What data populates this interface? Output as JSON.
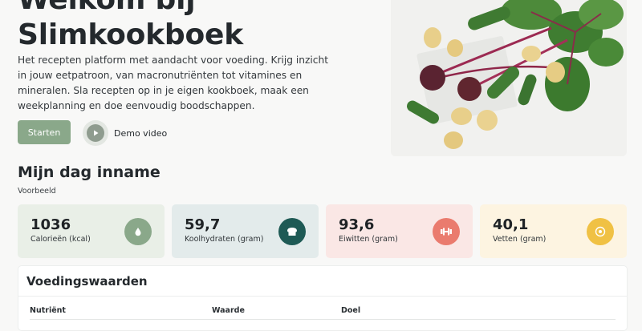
{
  "hero": {
    "title_line1": "Welkom bij",
    "title_line2": "Slimkookboek",
    "description": "Het recepten platform met aandacht voor voeding. Krijg inzicht in jouw eetpatroon, van macronutriënten tot vitamines en mineralen. Sla recepten op in je eigen kookboek, maak een weekplanning en doe eenvoudig boodschappen.",
    "start_button": "Starten",
    "demo_label": "Demo video"
  },
  "intake": {
    "title": "Mijn dag inname",
    "subtitle": "Voorbeeld",
    "cards": [
      {
        "value": "1036",
        "label": "Calorieën (kcal)",
        "bg": "#e9efe7",
        "icon_bg": "#8aa88a",
        "icon": "drop-icon"
      },
      {
        "value": "59,7",
        "label": "Koolhydraten (gram)",
        "bg": "#e3ebeb",
        "icon_bg": "#1e5a55",
        "icon": "bread-icon"
      },
      {
        "value": "93,6",
        "label": "Eiwitten (gram)",
        "bg": "#fae7e5",
        "icon_bg": "#ea7b6e",
        "icon": "dumbbell-icon"
      },
      {
        "value": "40,1",
        "label": "Vetten (gram)",
        "bg": "#fdf4e1",
        "icon_bg": "#f0c144",
        "icon": "oil-icon"
      }
    ]
  },
  "nutrition": {
    "title": "Voedingswaarden",
    "headers": [
      "Nutriënt",
      "Waarde",
      "Doel"
    ]
  }
}
